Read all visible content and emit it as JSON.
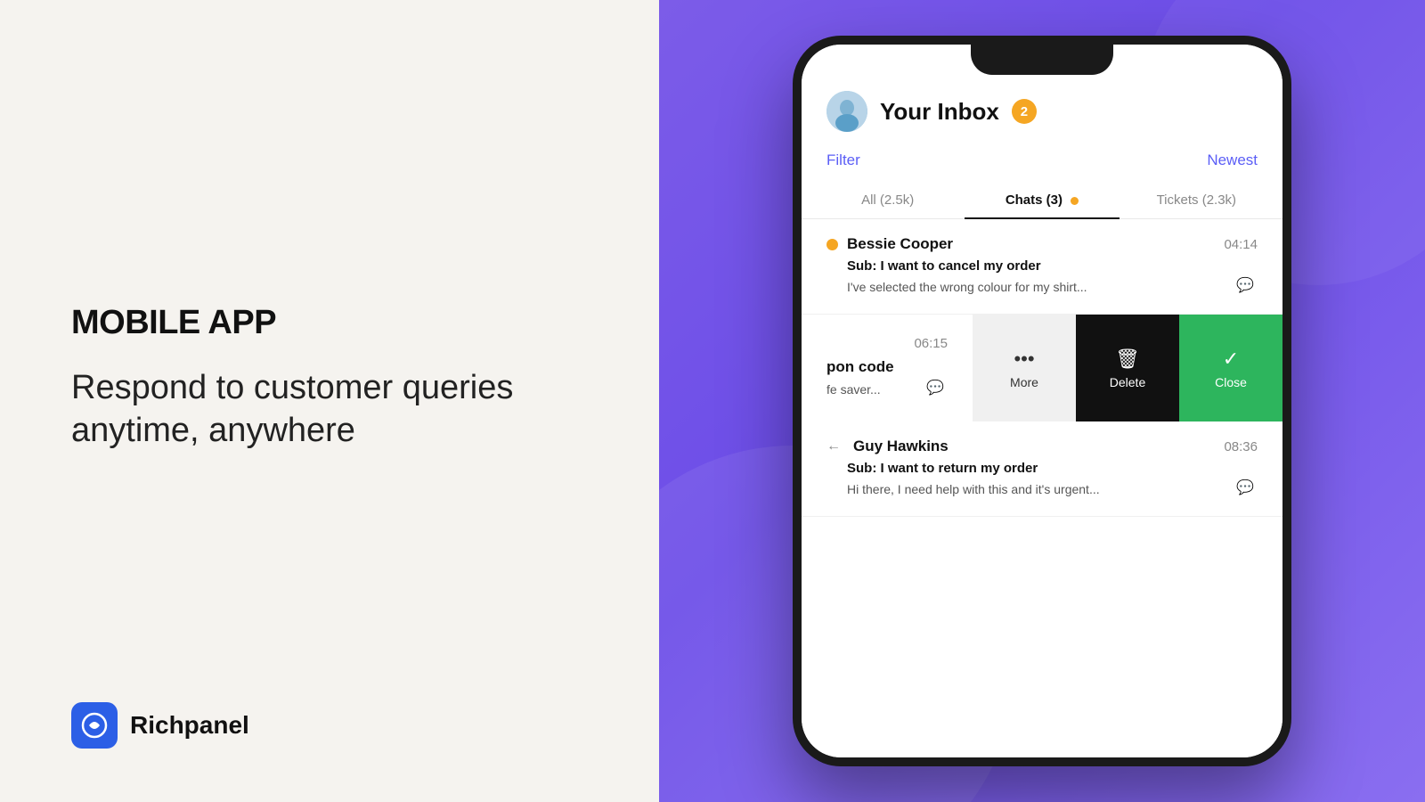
{
  "left": {
    "section_label": "MOBILE APP",
    "tagline_line1": "Respond to customer queries",
    "tagline_line2": "anytime, anywhere",
    "brand_name": "Richpanel"
  },
  "phone": {
    "header": {
      "title": "Your Inbox",
      "badge_count": "2",
      "filter_label": "Filter",
      "newest_label": "Newest"
    },
    "tabs": [
      {
        "label": "All (2.5k)",
        "active": false
      },
      {
        "label": "Chats (3)",
        "active": true,
        "dot": true
      },
      {
        "label": "Tickets (2.3k)",
        "active": false
      }
    ],
    "conversations": [
      {
        "name": "Bessie Cooper",
        "time": "04:14",
        "subject": "Sub: I want to cancel my order",
        "preview": "I've selected the wrong colour for my shirt...",
        "online": true
      }
    ],
    "swipe_item": {
      "time": "06:15",
      "subject": "pon code",
      "preview": "fe saver..."
    },
    "swipe_actions": {
      "more": "More",
      "delete": "Delete",
      "close": "Close"
    },
    "second_conversation": {
      "name": "Guy Hawkins",
      "time": "08:36",
      "subject": "Sub: I want to return my order",
      "preview": "Hi there, I need help with this and it's urgent...",
      "has_reply": true
    }
  }
}
